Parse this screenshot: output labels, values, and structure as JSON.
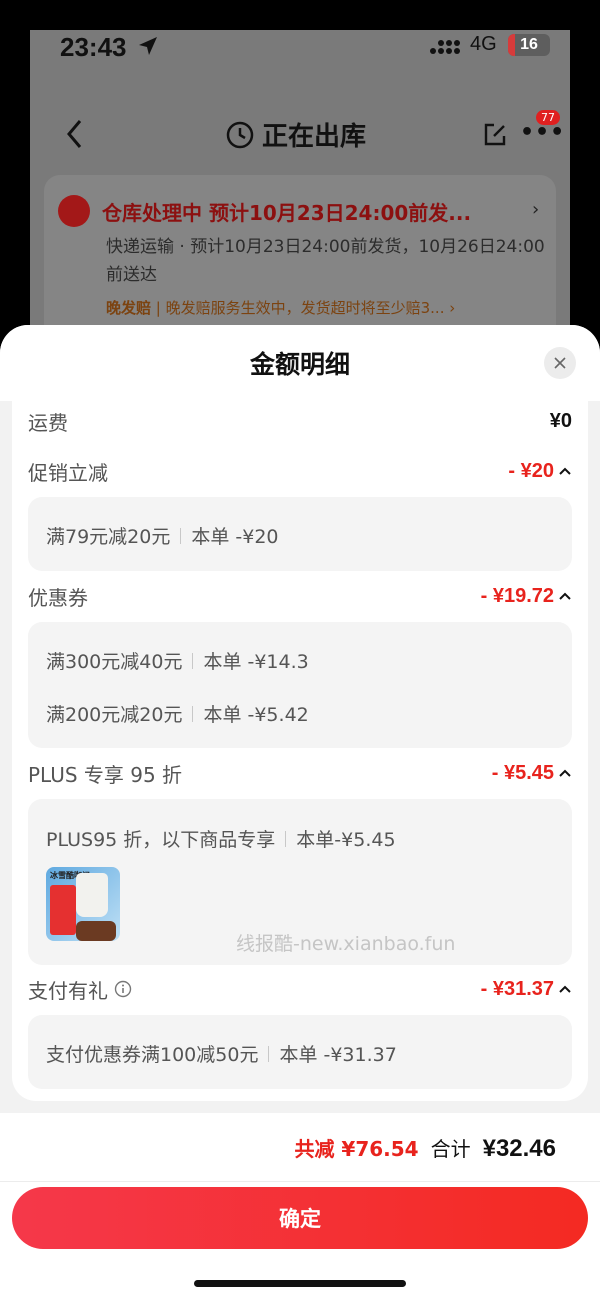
{
  "status_bar": {
    "time": "23:43",
    "network": "4G",
    "battery": "16"
  },
  "nav": {
    "title": "正在出库",
    "badge": "77"
  },
  "shipment": {
    "headline": "仓库处理中  预计10月23日24:00前发...",
    "detail": "快递运输 · 预计10月23日24:00前发货，10月26日24:00前送达",
    "guarantee_label": "晚发赔",
    "guarantee_text": "晚发赔服务生效中，发货超时将至少赔3..."
  },
  "sheet": {
    "title": "金额明细",
    "shipping": {
      "label": "运费",
      "amount": "¥0"
    },
    "promo": {
      "label": "促销立减",
      "amount": "- ¥20",
      "items": [
        {
          "rule": "满79元减20元",
          "value": "本单 -¥20"
        }
      ]
    },
    "coupon": {
      "label": "优惠券",
      "amount": "- ¥19.72",
      "items": [
        {
          "rule": "满300元减40元",
          "value": "本单 -¥14.3"
        },
        {
          "rule": "满200元减20元",
          "value": "本单 -¥5.42"
        }
      ]
    },
    "plus": {
      "label": "PLUS 专享 95 折",
      "amount": "- ¥5.45",
      "rule": "PLUS95 折，以下商品专享",
      "value": "本单-¥5.45",
      "product_title": "冰雪酷咖记"
    },
    "payment": {
      "label": "支付有礼",
      "amount": "- ¥31.37",
      "items": [
        {
          "rule": "支付优惠券满100减50元",
          "value": "本单 -¥31.37"
        }
      ]
    },
    "watermark": "线报酷-new.xianbao.fun"
  },
  "footer": {
    "saved": "共减 ¥76.54",
    "total_label": "合计",
    "total": "¥32.46",
    "confirm": "确定"
  },
  "colors": {
    "accent": "#e8231d",
    "button_start": "#f5384a",
    "button_end": "#f42a22"
  }
}
